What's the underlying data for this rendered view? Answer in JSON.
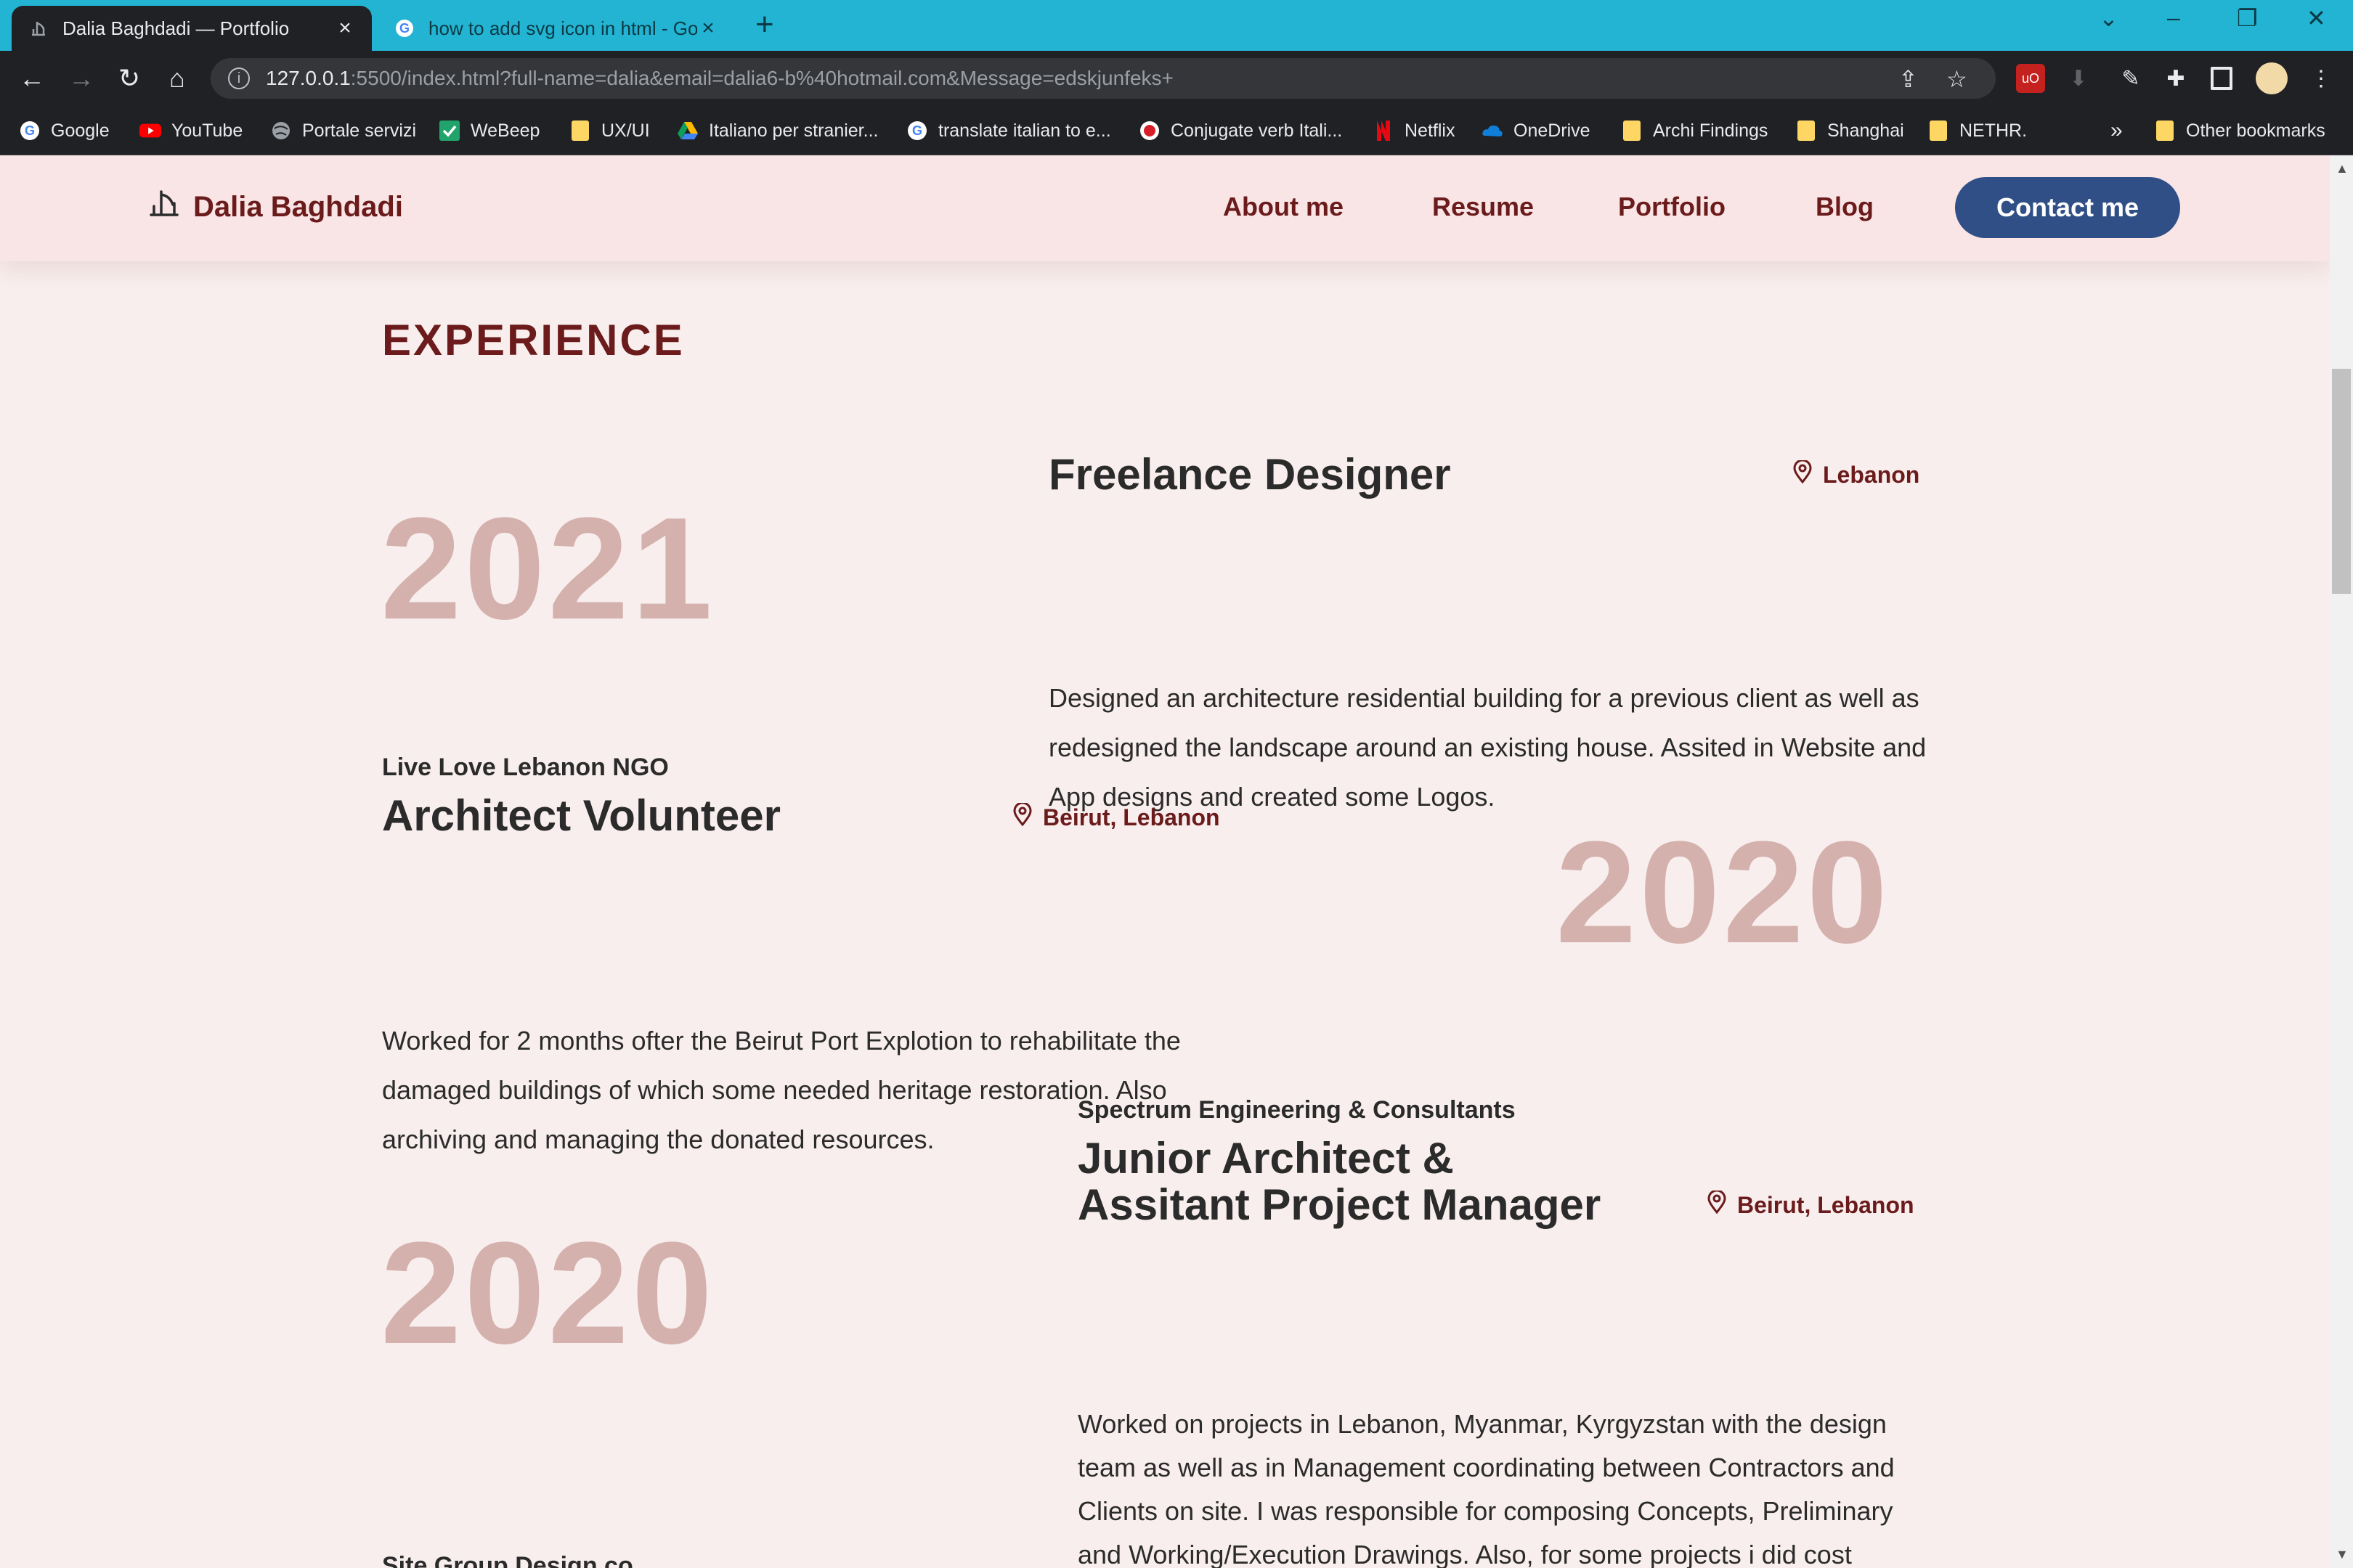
{
  "browser": {
    "tabs": [
      {
        "title": "Dalia Baghdadi — Portfolio",
        "active": true
      },
      {
        "title": "how to add svg icon in html - Go",
        "active": false
      }
    ],
    "address": {
      "host": "127.0.0.1",
      "rest": ":5500/index.html?full-name=dalia&email=dalia6-b%40hotmail.com&Message=edskjunfeks+"
    },
    "bookmarks": [
      {
        "label": "Google",
        "icon": "google-icon"
      },
      {
        "label": "YouTube",
        "icon": "youtube-icon"
      },
      {
        "label": "Portale servizi",
        "icon": "globe-icon"
      },
      {
        "label": "WeBeep",
        "icon": "check-icon"
      },
      {
        "label": "UX/UI",
        "icon": "folder-icon"
      },
      {
        "label": "Italiano per stranier...",
        "icon": "drive-icon"
      },
      {
        "label": "translate italian to e...",
        "icon": "google-icon"
      },
      {
        "label": "Conjugate verb Itali...",
        "icon": "reverso-icon"
      },
      {
        "label": "Netflix",
        "icon": "netflix-icon"
      },
      {
        "label": "OneDrive",
        "icon": "cloud-icon"
      },
      {
        "label": "Archi Findings",
        "icon": "folder-icon"
      },
      {
        "label": "Shanghai",
        "icon": "folder-icon"
      },
      {
        "label": "NETHR.",
        "icon": "folder-icon"
      }
    ],
    "overflow": "»",
    "other_bookmarks": "Other bookmarks",
    "colors": {
      "tabbar": "#22b4d2",
      "toolbar": "#202124"
    }
  },
  "site": {
    "logo": "Dalia Baghdadi",
    "nav": [
      "About me",
      "Resume",
      "Portfolio",
      "Blog"
    ],
    "contact": "Contact me",
    "colors": {
      "accent": "#6b1b1b",
      "button": "#2f4f86",
      "year": "#d4b1ad",
      "background": "#f8eeed"
    }
  },
  "experience": {
    "title": "EXPERIENCE",
    "items": [
      {
        "year": "2021",
        "company": "",
        "role": "Freelance Designer",
        "location": "Lebanon",
        "description": "Designed an architecture residential building for a previous client as well as redesigned the landscape around an existing house. Assited in Website and App designs and created some Logos."
      },
      {
        "year": "2020",
        "company": "Live Love Lebanon NGO",
        "role": "Architect Volunteer",
        "location": "Beirut, Lebanon",
        "description": "Worked for 2 months ofter the Beirut Port Explotion to rehabilitate the damaged buildings of which some needed heritage restoration. Also archiving and managing the donated resources."
      },
      {
        "year": "2020",
        "company": "Spectrum Engineering & Consultants",
        "role_line1": "Junior Architect &",
        "role_line2": "Assitant Project Manager",
        "location": "Beirut, Lebanon",
        "description": "Worked on projects in Lebanon, Myanmar, Kyrgyzstan with the design team as well as in Management coordinating between Contractors and Clients on site. I was responsible for composing Concepts, Preliminary and Working/Execution Drawings. Also, for some projects i did cost study report and BOQ reports."
      },
      {
        "company": "Site Group Design co."
      }
    ]
  }
}
